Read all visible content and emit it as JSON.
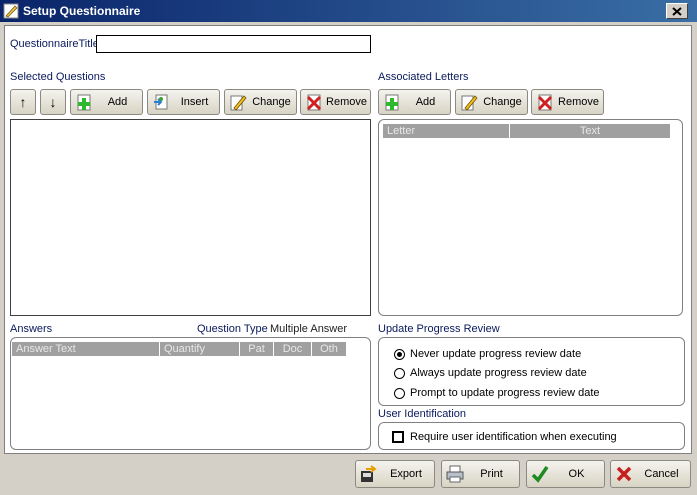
{
  "window": {
    "title": "Setup Questionnaire"
  },
  "form": {
    "questionnaire_title_label": "QuestionnaireTitle",
    "questionnaire_title_value": ""
  },
  "selected_questions": {
    "label": "Selected Questions",
    "buttons": {
      "up": "↑",
      "down": "↓",
      "add": "Add",
      "insert": "Insert",
      "change": "Change",
      "remove": "Remove"
    }
  },
  "associated_letters": {
    "label": "Associated Letters",
    "buttons": {
      "add": "Add",
      "change": "Change",
      "remove": "Remove"
    },
    "columns": [
      "Letter",
      "Text"
    ]
  },
  "answers": {
    "label": "Answers",
    "question_type_label": "Question Type",
    "question_type_value": "Multiple Answer",
    "columns": [
      "Answer Text",
      "Quantify",
      "Pat",
      "Doc",
      "Oth"
    ]
  },
  "update_progress_review": {
    "label": "Update Progress Review",
    "options": [
      {
        "label": "Never update progress review date",
        "selected": true
      },
      {
        "label": "Always update progress review date",
        "selected": false
      },
      {
        "label": "Prompt to update progress review date",
        "selected": false
      }
    ]
  },
  "user_identification": {
    "label": "User Identification",
    "require_label": "Require user identification when executing",
    "checked": false
  },
  "footer": {
    "export": "Export",
    "print": "Print",
    "ok": "OK",
    "cancel": "Cancel"
  },
  "colors": {
    "title_bar": "#0a246a",
    "label_text": "#0a1a5c",
    "header_gray": "#a0a0a0"
  }
}
